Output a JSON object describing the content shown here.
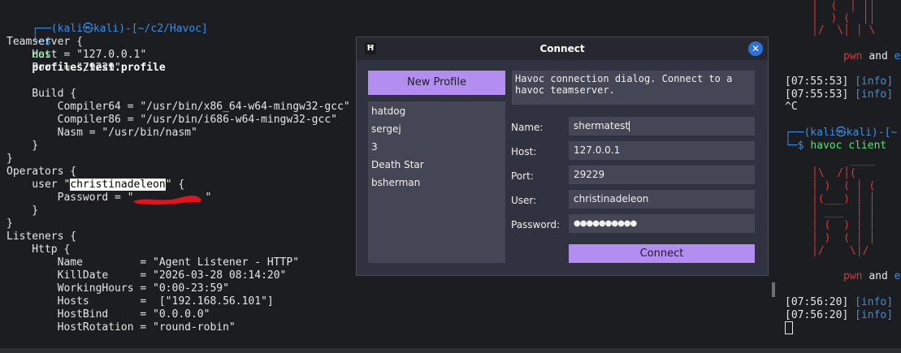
{
  "left_terminal": {
    "prompt_line1": "┌──(kali㉿kali)-[~/c2/Havoc]",
    "prompt_symbol": "└─$",
    "cmd": "cat",
    "cmd_arg": "profiles/test.profile",
    "lines": [
      "Teamserver {",
      "    Host = \"127.0.0.1\"",
      "    Port = \"29229\"",
      "",
      "    Build {",
      "        Compiler64 = \"/usr/bin/x86_64-w64-mingw32-gcc\"",
      "        Compiler86 = \"/usr/bin/i686-w64-mingw32-gcc\"",
      "        Nasm = \"/usr/bin/nasm\"",
      "    }",
      "}",
      "Operators {"
    ],
    "user_prefix": "    user \"",
    "user_name": "christinadeleon",
    "user_suffix": "\" {",
    "password_prefix": "        Password = \"",
    "password_suffix": "\"",
    "lines2": [
      "    }",
      "}",
      "Listeners {",
      "    Http {",
      "        Name         = \"Agent Listener - HTTP\"",
      "        KillDate     = \"2026-03-28 08:14:20\"",
      "        WorkingHours = \"0:00-23:59\"",
      "        Hosts        =  [\"192.168.56.101\"]",
      "        HostBind     = \"0.0.0.0\"",
      "        HostRotation = \"round-robin\""
    ]
  },
  "right_terminal": {
    "ascii_top": [
      "│  (  │ ││",
      "│  ) (  ││",
      "│/  \\│ │ \\"
    ],
    "pwn1": "pwn",
    "and1": "and",
    "e1": "e",
    "log1": [
      {
        "time": "[07:55:53]",
        "tag": "[info]"
      },
      {
        "time": "[07:55:53]",
        "tag": "[info]"
      }
    ],
    "ctrl_c": "^C",
    "prompt_line1": "┌──(kali㉿kali)-[~",
    "prompt_symbol": "└─$",
    "cmd": "havoc client",
    "ascii_bottom": [
      "      ____",
      "│\\  /│( ",
      "│ )  ( │ (",
      "│(___) │ │",
      "│ ___  │ │",
      "│ (  ) │ │",
      "│ )  ( │ │",
      "│/    \\│/ "
    ],
    "pwn2": "pwn",
    "and2": "and",
    "e2": "e",
    "log2": [
      {
        "time": "[07:56:20]",
        "tag": "[info]"
      },
      {
        "time": "[07:56:20]",
        "tag": "[info]"
      }
    ]
  },
  "dialog": {
    "app_icon": "Ħ",
    "title": "Connect",
    "close_icon": "✕",
    "new_profile_label": "New Profile",
    "profiles": [
      "hatdog",
      "sergej",
      "3",
      "Death Star",
      "bsherman"
    ],
    "description": "Havoc connection dialog. Connect to a havoc teamserver.",
    "labels": {
      "name": "Name:",
      "host": "Host:",
      "port": "Port:",
      "user": "User:",
      "password": "Password:"
    },
    "values": {
      "name": "shermatest",
      "host": "127.0.0.1",
      "port": "29229",
      "user": "christinadeleon",
      "password": "●●●●●●●●●●"
    },
    "connect_label": "Connect"
  },
  "colors": {
    "accent": "#b38df0",
    "close": "#2f6fd8",
    "prompt_blue": "#3a8ee6",
    "prompt_green": "#54e36f",
    "banner_red": "#d83a3a",
    "redaction": "#e0141e"
  }
}
